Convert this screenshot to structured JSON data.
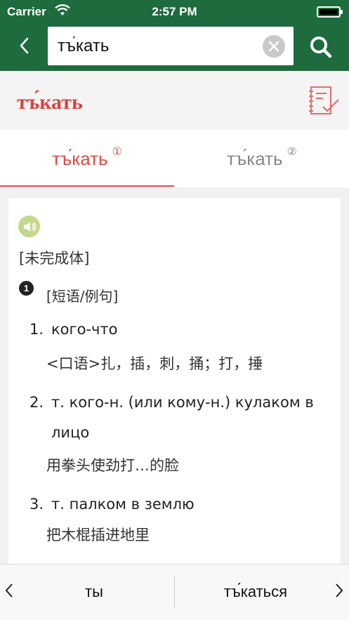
{
  "status": {
    "carrier": "Carrier",
    "time": "2:57 PM"
  },
  "search": {
    "value": "тъ́кать"
  },
  "headword": "тъ́кать",
  "tabs": [
    {
      "label": "тъ́кать",
      "sup": "①",
      "active": true
    },
    {
      "label": "тъ́кать",
      "sup": "②",
      "active": false
    }
  ],
  "entry": {
    "aspect": "[未完成体]",
    "sense_number": "1",
    "sense_label": "[短语/例句]",
    "examples": [
      {
        "num": "1.",
        "ru": "кого-что",
        "zh": "<口语>扎，插，刺，捅；打，捶"
      },
      {
        "num": "2.",
        "ru_line1": "т. кого-н. (или кому-н.) кулаком в",
        "ru_line2": "лицо",
        "zh": "用拳头使劲打…的脸"
      },
      {
        "num": "3.",
        "ru": "т. палком в землю",
        "zh": "把木棍插进地里"
      }
    ]
  },
  "nav": {
    "prev": "ты",
    "next": "тъ́каться"
  },
  "colors": {
    "topbar": "#1e6b3d",
    "accent": "#e04b45",
    "speaker": "#c3d88c"
  }
}
